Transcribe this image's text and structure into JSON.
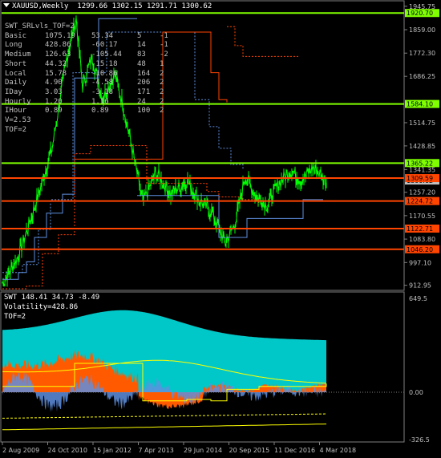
{
  "window": {
    "symbol_timeframe": "XAUUSD,Weekly",
    "ohlc": "1299.66 1302.15 1291.71 1300.62"
  },
  "indicator_panel": {
    "name": "SWT_SRLvls_TOF=2",
    "rows": [
      {
        "label": "Basic",
        "v1": "1075.19",
        "v2": "53.34",
        "v3": "5",
        "v4": "-1"
      },
      {
        "label": "Long",
        "v1": "428.86",
        "v2": "-60.17",
        "v3": "14",
        "v4": "-1"
      },
      {
        "label": "Medium",
        "v1": "126.63",
        "v2": "-105.44",
        "v3": "83",
        "v4": "-2"
      },
      {
        "label": "Short",
        "v1": "44.32",
        "v2": "-15.18",
        "v3": "48",
        "v4": "1"
      },
      {
        "label": "Local",
        "v1": "15.78",
        "v2": "-10.86",
        "v3": "164",
        "v4": "2"
      },
      {
        "label": "Daily",
        "v1": "4.90",
        "v2": "-4.58",
        "v3": "206",
        "v4": "2"
      },
      {
        "label": "IDay",
        "v1": "3.03",
        "v2": "-3.18",
        "v3": "171",
        "v4": "2"
      },
      {
        "label": "Hourly",
        "v1": "1.20",
        "v2": "1.16",
        "v3": "24",
        "v4": "2"
      },
      {
        "label": "IHour",
        "v1": "0.89",
        "v2": "0.89",
        "v3": "100",
        "v4": "2"
      }
    ],
    "v_line": "V=2.53",
    "tof_line": "TOF=2"
  },
  "price_axis": {
    "ticks": [
      "1945.75",
      "1859.00",
      "1772.30",
      "1686.25",
      "1514.75",
      "1428.85",
      "1341.35",
      "1257.20",
      "1170.55",
      "1083.80",
      "997.10",
      "912.95"
    ],
    "level_labels": [
      {
        "value": "1920.70",
        "color": "#7fff00",
        "text_color": "#000000"
      },
      {
        "value": "1584.10",
        "color": "#7fff00",
        "text_color": "#000000"
      },
      {
        "value": "1365.22",
        "color": "#7fff00",
        "text_color": "#000000"
      },
      {
        "value": "1300.62",
        "color": "#c0c0c0",
        "text_color": "#000000"
      },
      {
        "value": "1309.59",
        "color": "#ff4500",
        "text_color": "#000000"
      },
      {
        "value": "1224.72",
        "color": "#ff4500",
        "text_color": "#000000"
      },
      {
        "value": "1122.71",
        "color": "#ff4500",
        "text_color": "#000000"
      },
      {
        "value": "1046.20",
        "color": "#ff4500",
        "text_color": "#000000"
      }
    ]
  },
  "sub_window": {
    "header": "SWT 148.41 34.73 -8.49",
    "volatility": "Volatility=428.86",
    "tof": "TOF=2",
    "axis_ticks": [
      "649.5",
      "0.00",
      "-326.5"
    ]
  },
  "time_axis": [
    "2 Aug 2009",
    "24 Oct 2010",
    "15 Jan 2012",
    "7 Apr 2013",
    "29 Jun 2014",
    "20 Sep 2015",
    "11 Dec 2016",
    "4 Mar 2018"
  ],
  "colors": {
    "background": "#000000",
    "candles": "#00ff00",
    "support_green": "#7fff00",
    "resistance_red": "#ff4500",
    "blue_levels": "#5f8fdf",
    "cyan_fill": "#00c8c8",
    "orange_fill": "#ff5a00",
    "yellow_line": "#ffff00"
  }
}
